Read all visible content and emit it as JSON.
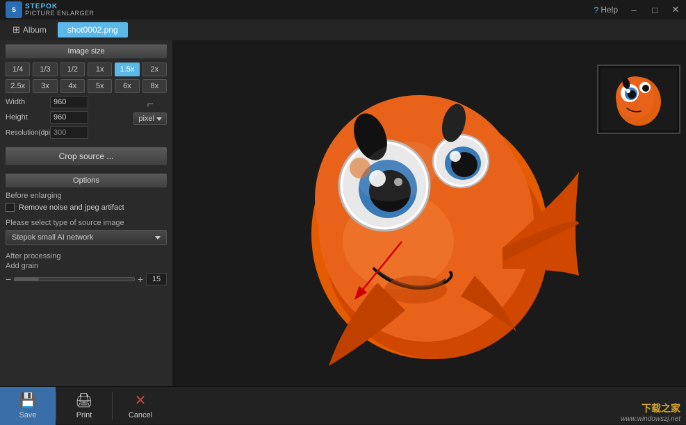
{
  "app": {
    "title_line1": "STEPOK",
    "title_line2": "PICTURE ENLARGER",
    "help_label": "Help"
  },
  "tabs": {
    "album_label": "Album",
    "file_label": "shot0002.png"
  },
  "image_size": {
    "section_label": "Image size",
    "scales": [
      "1/4",
      "1/3",
      "1/2",
      "1x",
      "1.5x",
      "2x",
      "2.5x",
      "3x",
      "4x",
      "5x",
      "6x",
      "8x"
    ],
    "active_scale": "1.5x",
    "width_label": "Width",
    "height_label": "Height",
    "resolution_label": "Resolution(dpi)",
    "width_value": "960",
    "height_value": "960",
    "resolution_value": "300",
    "pixel_label": "pixel",
    "crop_btn_label": "Crop source ..."
  },
  "options": {
    "section_label": "Options",
    "before_label": "Before enlarging",
    "checkbox_label": "Remove noise and jpeg artifact",
    "select_label": "Please select type of source image",
    "ai_network_label": "Stepok small AI network",
    "after_label": "After processing",
    "grain_label": "Add grain",
    "grain_value": "15"
  },
  "bottom": {
    "save_label": "Save",
    "print_label": "Print",
    "cancel_label": "Cancel"
  },
  "watermark": {
    "site": "www.windowszj.net",
    "brand": "下载之家"
  }
}
